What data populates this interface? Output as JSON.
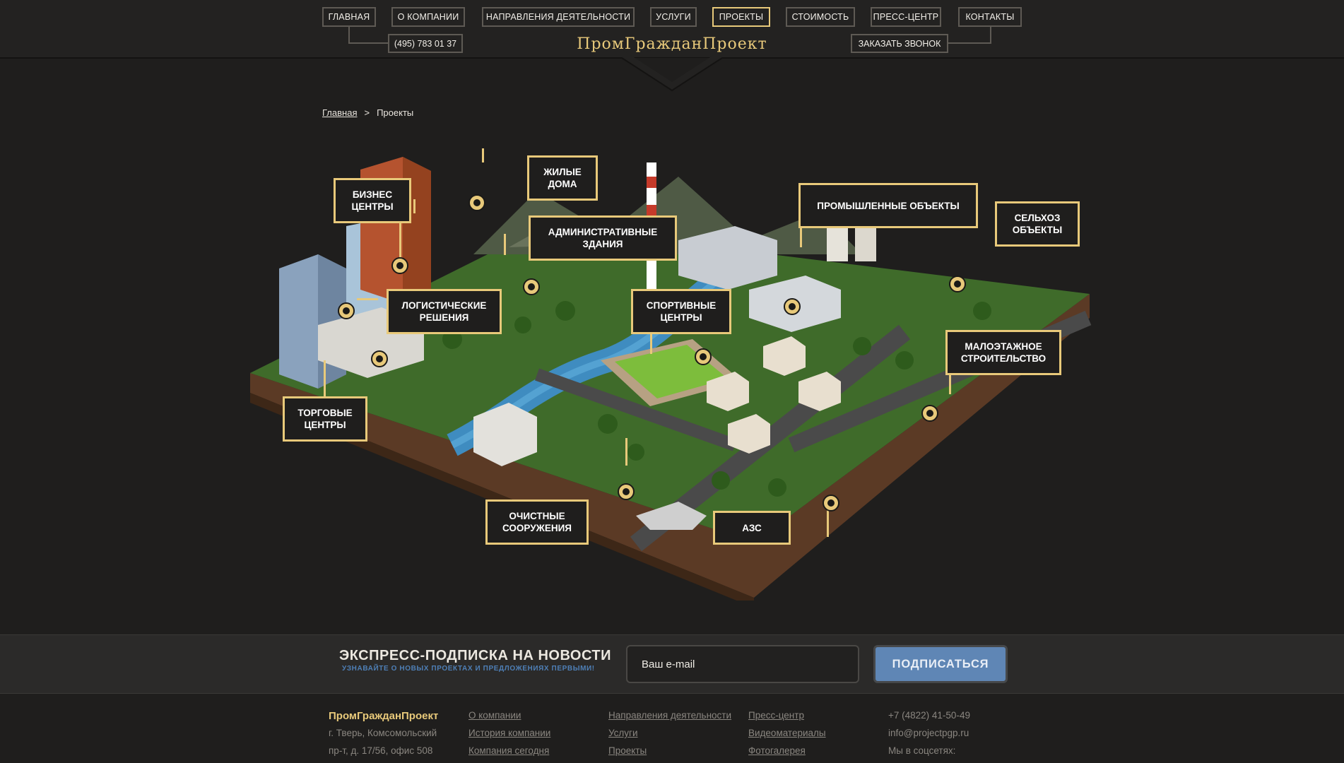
{
  "nav": {
    "items": [
      {
        "label": "ГЛАВНАЯ",
        "active": false
      },
      {
        "label": "О КОМПАНИИ",
        "active": false
      },
      {
        "label": "НАПРАВЛЕНИЯ ДЕЯТЕЛЬНОСТИ",
        "active": false
      },
      {
        "label": "УСЛУГИ",
        "active": false
      },
      {
        "label": "ПРОЕКТЫ",
        "active": true
      },
      {
        "label": "СТОИМОСТЬ",
        "active": false
      },
      {
        "label": "ПРЕСС-ЦЕНТР",
        "active": false
      },
      {
        "label": "КОНТАКТЫ",
        "active": false
      }
    ],
    "phone": "(495) 783 01 37",
    "logo": "ПромГражданПроект",
    "callback": "ЗАКАЗАТЬ ЗВОНОК"
  },
  "breadcrumb": {
    "home": "Главная",
    "separator": ">",
    "current": "Проекты"
  },
  "map": {
    "categories": [
      {
        "label": "БИЗНЕС ЦЕНТРЫ"
      },
      {
        "label": "ЖИЛЫЕ ДОМА"
      },
      {
        "label": "АДМИНИСТРАТИВНЫЕ ЗДАНИЯ"
      },
      {
        "label": "ЛОГИСТИЧЕСКИЕ РЕШЕНИЯ"
      },
      {
        "label": "ТОРГОВЫЕ ЦЕНТРЫ"
      },
      {
        "label": "СПОРТИВНЫЕ ЦЕНТРЫ"
      },
      {
        "label": "ПРОМЫШЛЕННЫЕ ОБЪЕКТЫ"
      },
      {
        "label": "СЕЛЬХОЗ ОБЪЕКТЫ"
      },
      {
        "label": "МАЛОЭТАЖНОЕ СТРОИТЕЛЬСТВО"
      },
      {
        "label": "ОЧИСТНЫЕ СООРУЖЕНИЯ"
      },
      {
        "label": "АЗС"
      }
    ]
  },
  "subscribe": {
    "title": "ЭКСПРЕСС-ПОДПИСКА НА НОВОСТИ",
    "subtitle": "УЗНАВАЙТЕ О НОВЫХ ПРОЕКТАХ И ПРЕДЛОЖЕНИЯХ ПЕРВЫМИ!",
    "placeholder": "Ваш e-mail",
    "button": "ПОДПИСАТЬСЯ"
  },
  "footer": {
    "brand": "ПромГражданПроект",
    "address_line1": "г. Тверь, Комсомольский",
    "address_line2": "пр-т, д. 17/56, офис 508",
    "col1": [
      "О компании",
      "История компании",
      "Компания сегодня"
    ],
    "col2": [
      "Направления деятельности",
      "Услуги",
      "Проекты"
    ],
    "col3": [
      "Пресс-центр",
      "Видеоматериалы",
      "Фотогалерея"
    ],
    "phone": "+7 (4822) 41-50-49",
    "email": "info@projectpgp.ru",
    "social": "Мы в соцсетях:"
  },
  "colors": {
    "accent": "#e8c97a",
    "background": "#1f1e1d",
    "button_blue": "#5f86b5"
  }
}
